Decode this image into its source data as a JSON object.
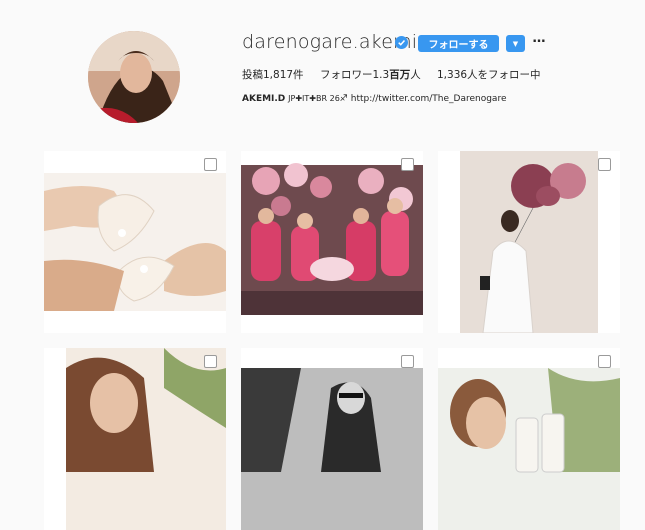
{
  "profile": {
    "username": "darenogare.akemi",
    "verified_icon": "verified-badge-icon",
    "follow_label": "フォローする",
    "more_label": "…"
  },
  "stats": {
    "posts": "投稿1,817件",
    "followers_prefix": "フォロワー1.3",
    "followers_unit": "百万",
    "followers_suffix": "人",
    "following": "1,336人をフォロー中"
  },
  "bio": {
    "name": "AKEMI.D",
    "flags": "JP✚IT✚BR 26",
    "symbol": "♐",
    "link": "http://twitter.com/The_Darenogare"
  },
  "colors": {
    "accent": "#3897f0",
    "background": "#fafafa"
  },
  "posts": [
    {
      "alt_icon": "checkbox-icon"
    },
    {
      "alt_icon": "checkbox-icon"
    },
    {
      "alt_icon": "checkbox-icon"
    },
    {
      "alt_icon": "checkbox-icon"
    },
    {
      "alt_icon": "checkbox-icon"
    },
    {
      "alt_icon": "checkbox-icon"
    }
  ]
}
